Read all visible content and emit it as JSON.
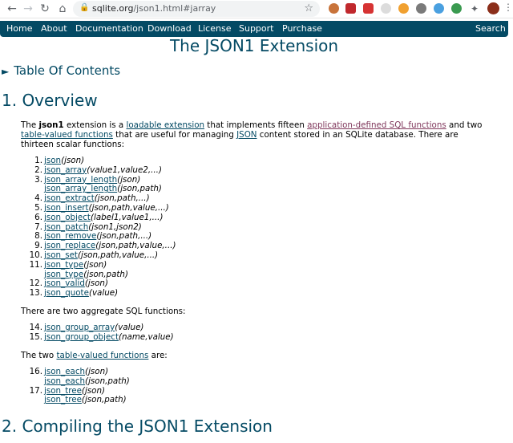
{
  "browser": {
    "url_host": "sqlite.org",
    "url_path": "/json1.html#jarray"
  },
  "nav": {
    "items": [
      "Home",
      "About",
      "Documentation",
      "Download",
      "License",
      "Support",
      "Purchase"
    ],
    "search": "Search"
  },
  "page": {
    "title": "The JSON1 Extension",
    "toc": "Table Of Contents"
  },
  "section1": {
    "heading": "1. Overview",
    "intro": {
      "t1": "The ",
      "bold": "json1",
      "t2": " extension is a ",
      "link1": "loadable extension",
      "t3": " that implements fifteen ",
      "link2": "application-defined SQL functions",
      "t4": " and two ",
      "link3": "table-valued functions",
      "t5": " that are useful for managing ",
      "link4": "JSON",
      "t6": " content stored in an SQLite database. There are thirteen scalar functions:"
    },
    "scalar_functions": [
      {
        "n": "1.",
        "lines": [
          {
            "name": "json",
            "args": "(json)"
          }
        ]
      },
      {
        "n": "2.",
        "lines": [
          {
            "name": "json_array",
            "args": "(value1,value2,...)"
          }
        ]
      },
      {
        "n": "3.",
        "lines": [
          {
            "name": "json_array_length",
            "args": "(json)"
          },
          {
            "name": "json_array_length",
            "args": "(json,path)"
          }
        ]
      },
      {
        "n": "4.",
        "lines": [
          {
            "name": "json_extract",
            "args": "(json,path,...)"
          }
        ]
      },
      {
        "n": "5.",
        "lines": [
          {
            "name": "json_insert",
            "args": "(json,path,value,...)"
          }
        ]
      },
      {
        "n": "6.",
        "lines": [
          {
            "name": "json_object",
            "args": "(label1,value1,...)"
          }
        ]
      },
      {
        "n": "7.",
        "lines": [
          {
            "name": "json_patch",
            "args": "(json1,json2)"
          }
        ]
      },
      {
        "n": "8.",
        "lines": [
          {
            "name": "json_remove",
            "args": "(json,path,...)"
          }
        ]
      },
      {
        "n": "9.",
        "lines": [
          {
            "name": "json_replace",
            "args": "(json,path,value,...)"
          }
        ]
      },
      {
        "n": "10.",
        "lines": [
          {
            "name": "json_set",
            "args": "(json,path,value,...)"
          }
        ]
      },
      {
        "n": "11.",
        "lines": [
          {
            "name": "json_type",
            "args": "(json)"
          },
          {
            "name": "json_type",
            "args": "(json,path)"
          }
        ]
      },
      {
        "n": "12.",
        "lines": [
          {
            "name": "json_valid",
            "args": "(json)"
          }
        ]
      },
      {
        "n": "13.",
        "lines": [
          {
            "name": "json_quote",
            "args": "(value)"
          }
        ]
      }
    ],
    "aggregate_intro": "There are two aggregate SQL functions:",
    "aggregate_functions": [
      {
        "n": "14.",
        "lines": [
          {
            "name": "json_group_array",
            "args": "(value)"
          }
        ]
      },
      {
        "n": "15.",
        "lines": [
          {
            "name": "json_group_object",
            "args": "(name,value)"
          }
        ]
      }
    ],
    "tvf_intro": {
      "t1": "The two ",
      "link": "table-valued functions",
      "t2": " are:"
    },
    "table_functions": [
      {
        "n": "16.",
        "lines": [
          {
            "name": "json_each",
            "args": "(json)"
          },
          {
            "name": "json_each",
            "args": "(json,path)"
          }
        ]
      },
      {
        "n": "17.",
        "lines": [
          {
            "name": "json_tree",
            "args": "(json)"
          },
          {
            "name": "json_tree",
            "args": "(json,path)"
          }
        ]
      }
    ]
  },
  "section2": {
    "heading": "2. Compiling the JSON1 Extension"
  }
}
